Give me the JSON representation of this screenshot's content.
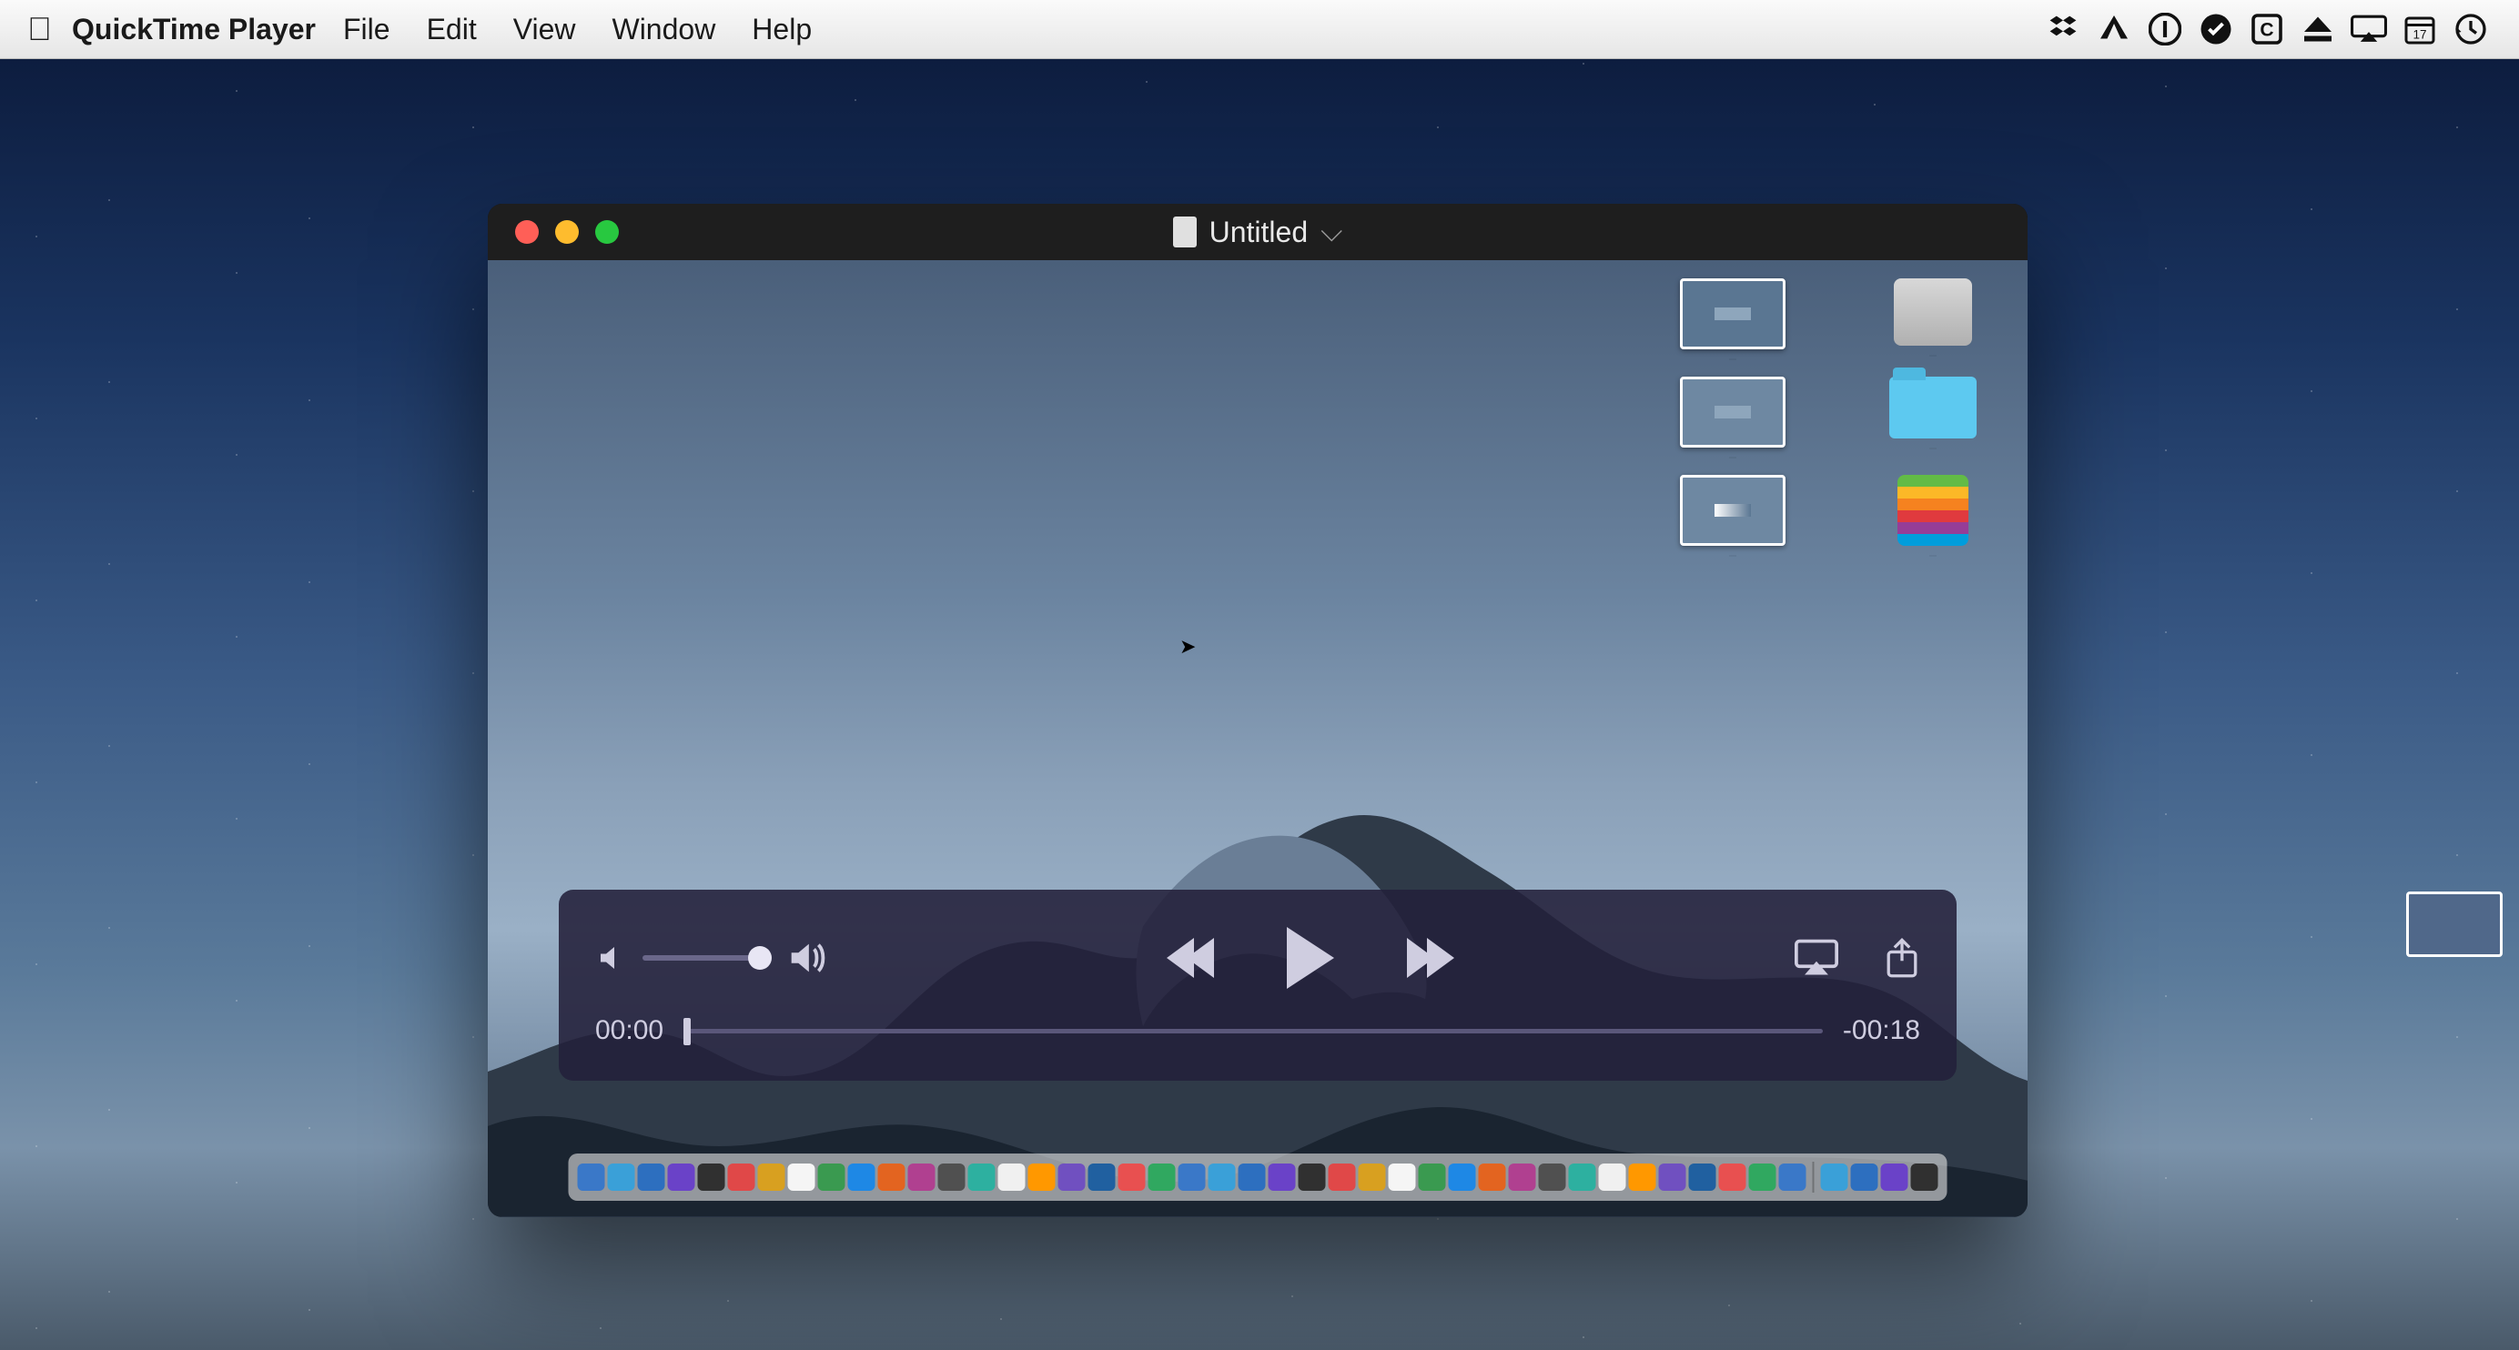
{
  "menubar": {
    "app_name": "QuickTime Player",
    "items": [
      "File",
      "Edit",
      "View",
      "Window",
      "Help"
    ],
    "extras": [
      "dropbox-icon",
      "google-drive-icon",
      "onepassword-menubar-icon",
      "sync-ok-icon",
      "app-c-icon",
      "eject-icon",
      "airplay-icon",
      "date-icon",
      "time-machine-icon"
    ]
  },
  "window": {
    "title": "Untitled",
    "traffic_lights": [
      "close",
      "minimize",
      "zoom"
    ]
  },
  "player": {
    "time_elapsed": "00:00",
    "time_remaining": "-00:18",
    "volume_percent": 100,
    "progress_percent": 0
  },
  "desktop_icons_in_recording": {
    "col1": [
      {
        "kind": "screenshot",
        "label": ""
      },
      {
        "kind": "screenshot",
        "label": ""
      },
      {
        "kind": "screenshot",
        "label": ""
      }
    ],
    "col2": [
      {
        "kind": "drive",
        "label": ""
      },
      {
        "kind": "folder",
        "label": ""
      },
      {
        "kind": "apple-logo",
        "label": ""
      }
    ]
  },
  "host_desktop_icon": {
    "label": ""
  },
  "dock_app_count": 45,
  "colors": {
    "control_bg": "#23203a",
    "control_fg": "#cfcde0",
    "apple_stripes": [
      "#62bb46",
      "#fcb827",
      "#f6821f",
      "#e03a3e",
      "#963d97",
      "#009ddc"
    ]
  }
}
